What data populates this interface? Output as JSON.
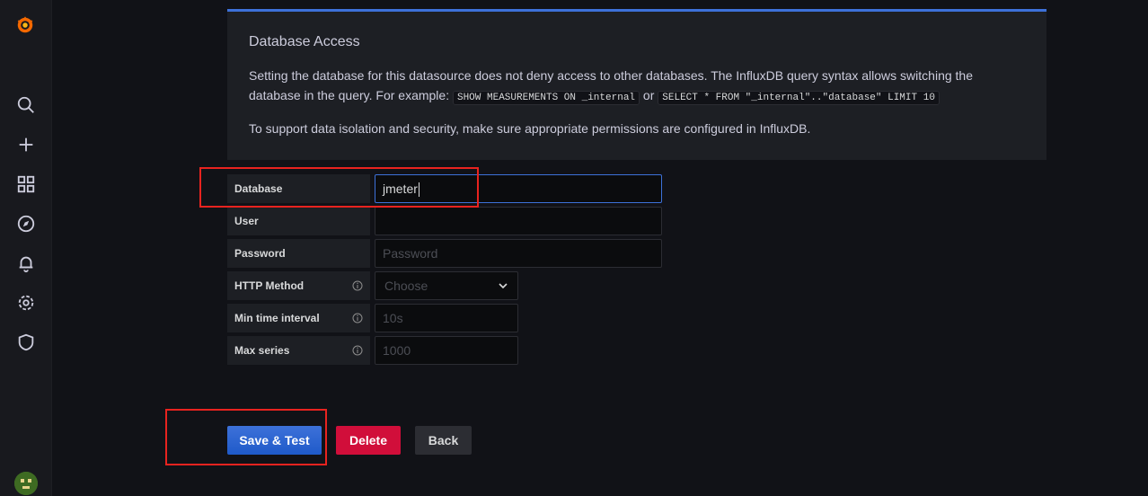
{
  "sidebar": {
    "icons": [
      "grafana-logo-icon",
      "search-icon",
      "plus-icon",
      "dashboards-icon",
      "explore-icon",
      "alerting-icon",
      "settings-icon",
      "shield-icon"
    ]
  },
  "access_panel": {
    "title": "Database Access",
    "text_part1": "Setting the database for this datasource does not deny access to other databases. The InfluxDB query syntax allows switching the database in the query. For example:",
    "code1": "SHOW MEASUREMENTS ON _internal",
    "or": "or",
    "code2": "SELECT * FROM \"_internal\"..\"database\" LIMIT 10",
    "text2": "To support data isolation and security, make sure appropriate permissions are configured in InfluxDB."
  },
  "form": {
    "database": {
      "label": "Database",
      "value": "jmeter"
    },
    "user": {
      "label": "User",
      "value": ""
    },
    "password": {
      "label": "Password",
      "placeholder": "Password"
    },
    "http_method": {
      "label": "HTTP Method",
      "placeholder": "Choose"
    },
    "min_time_interval": {
      "label": "Min time interval",
      "placeholder": "10s"
    },
    "max_series": {
      "label": "Max series",
      "placeholder": "1000"
    }
  },
  "buttons": {
    "save": "Save & Test",
    "delete": "Delete",
    "back": "Back"
  },
  "colors": {
    "accent": "#3d71d9",
    "danger": "#d10e3a",
    "annotation": "#e8231f"
  }
}
